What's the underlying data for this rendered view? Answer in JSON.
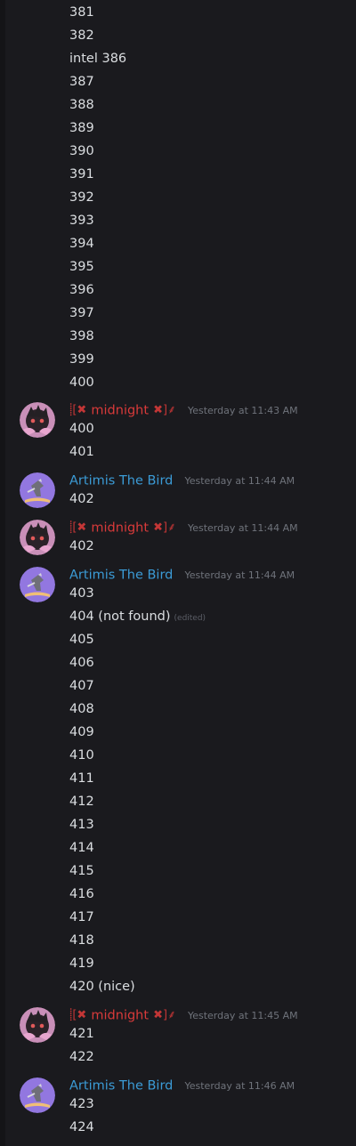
{
  "lines_top": [
    "381",
    "382",
    "intel 386",
    "387",
    "388",
    "389",
    "390",
    "391",
    "392",
    "393",
    "394",
    "395",
    "396",
    "397",
    "398",
    "399",
    "400"
  ],
  "groups": [
    {
      "user": "midnight",
      "timestamp": "Yesterday at 11:43 AM",
      "lines": [
        "400",
        "401"
      ]
    },
    {
      "user": "Artimis The Bird",
      "timestamp": "Yesterday at 11:44 AM",
      "lines": [
        "402"
      ]
    },
    {
      "user": "midnight",
      "timestamp": "Yesterday at 11:44 AM",
      "lines": [
        "402"
      ]
    },
    {
      "user": "Artimis The Bird",
      "timestamp": "Yesterday at 11:44 AM",
      "lines": [
        "403",
        "404 (not found)",
        "405",
        "406",
        "407",
        "408",
        "409",
        "410",
        "411",
        "412",
        "413",
        "414",
        "415",
        "416",
        "417",
        "418",
        "419",
        "420 (nice)"
      ],
      "edited_label": "(edited)"
    },
    {
      "user": "midnight",
      "timestamp": "Yesterday at 11:45 AM",
      "lines": [
        "421",
        "422"
      ]
    },
    {
      "user": "Artimis The Bird",
      "timestamp": "Yesterday at 11:46 AM",
      "lines": [
        "423",
        "424"
      ]
    }
  ],
  "colors": {
    "artimis": "#3b9bd6",
    "midnight": "#d83a3a",
    "background": "#1a1a1e"
  }
}
